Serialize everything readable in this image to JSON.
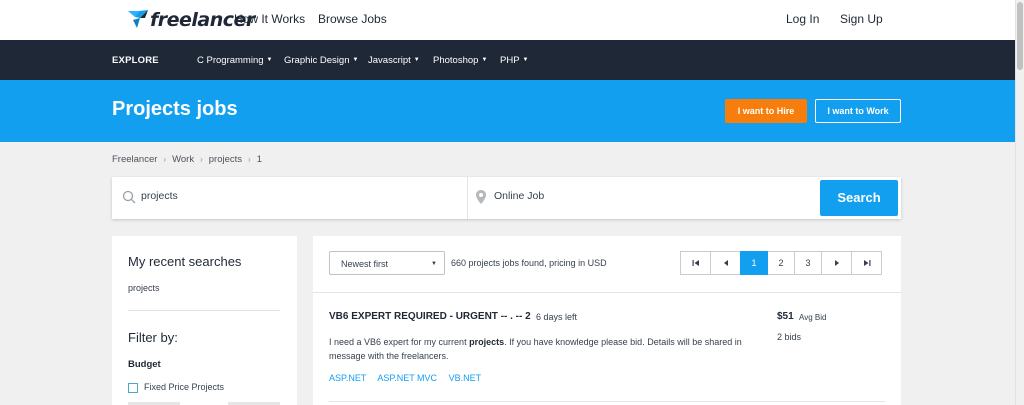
{
  "header": {
    "brand": "freelancer",
    "nav_left": [
      "How It Works",
      "Browse Jobs"
    ],
    "log_in": "Log In",
    "sign_up": "Sign Up"
  },
  "explore": {
    "label": "EXPLORE",
    "categories": [
      "C Programming",
      "Graphic Design",
      "Javascript",
      "Photoshop",
      "PHP"
    ],
    "caret": "▼"
  },
  "hero": {
    "title": "Projects jobs",
    "hire_button": "I want to Hire",
    "work_button": "I want to Work"
  },
  "breadcrumb": {
    "items": [
      "Freelancer",
      "Work",
      "projects",
      "1"
    ],
    "separator": "›"
  },
  "search": {
    "keyword_value": "projects",
    "location_value": "Online Job",
    "button": "Search"
  },
  "sidebar": {
    "recent_title": "My recent searches",
    "recent_items": [
      "projects"
    ],
    "filter_title": "Filter by:",
    "budget_label": "Budget",
    "fixed_label": "Fixed Price Projects"
  },
  "results": {
    "sort_selected": "Newest first",
    "count_text": "660 projects jobs found, pricing in USD",
    "pages": [
      "1",
      "2",
      "3"
    ],
    "active_page": "1"
  },
  "project": {
    "title": "VB6 EXPERT REQUIRED - URGENT -- . -- 2",
    "age": "6 days left",
    "desc_before": "I need a VB6 expert for my current ",
    "desc_bold": "projects",
    "desc_after": ". If you have knowledge please bid. Details will be shared in message with the freelancers.",
    "tags": [
      "ASP.NET",
      "ASP.NET MVC",
      "VB.NET"
    ],
    "bid_amount": "$51",
    "bid_label": "Avg Bid",
    "bid_count": "2 bids"
  },
  "colors": {
    "brand_blue": "#139ff0",
    "navy": "#1f2836",
    "hire_orange": "#f77e0c",
    "page_bg": "#f0f0f0"
  }
}
